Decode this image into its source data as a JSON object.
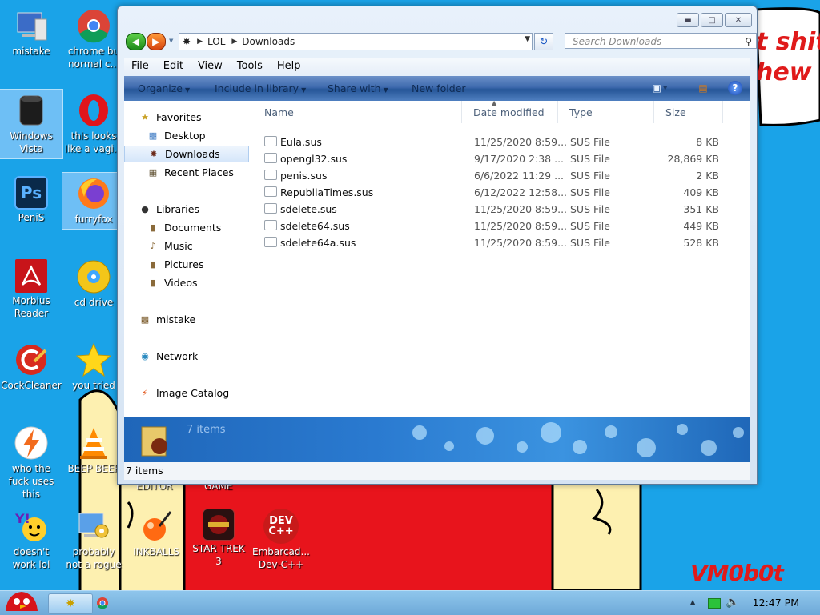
{
  "desktop": {
    "icons": [
      {
        "label": "mistake"
      },
      {
        "label": "chrome bu normal c..."
      },
      {
        "label": "Windows Vista"
      },
      {
        "label": "this looks like a vagi..."
      },
      {
        "label": "PeniS"
      },
      {
        "label": "furryfox"
      },
      {
        "label": "Morbius Reader"
      },
      {
        "label": "cd drive"
      },
      {
        "label": "CockCleaner"
      },
      {
        "label": "you tried"
      },
      {
        "label": "who the fuck uses this"
      },
      {
        "label": "BEEP BEEP"
      },
      {
        "label": "EDITOR"
      },
      {
        "label": "GAME"
      },
      {
        "label": "doesn't work lol"
      },
      {
        "label": "probably not a rogue"
      },
      {
        "label": "INKBALLS"
      },
      {
        "label": "STAR TREK 3"
      },
      {
        "label": "Embarcad... Dev-C++"
      }
    ],
    "wallpaper_text": [
      "t shit",
      "hew"
    ],
    "watermark": "VM0b0t"
  },
  "window": {
    "address": {
      "segments": [
        "LOL",
        "Downloads"
      ]
    },
    "search_placeholder": "Search Downloads",
    "menu": [
      "File",
      "Edit",
      "View",
      "Tools",
      "Help"
    ],
    "commands": [
      "Organize",
      "Include in library",
      "Share with",
      "New folder"
    ],
    "nav": {
      "favorites": "Favorites",
      "desktop": "Desktop",
      "downloads": "Downloads",
      "recent": "Recent Places",
      "libraries": "Libraries",
      "documents": "Documents",
      "music": "Music",
      "pictures": "Pictures",
      "videos": "Videos",
      "homegroup": "mistake",
      "network": "Network",
      "imagecatalog": "Image Catalog"
    },
    "columns": [
      "Name",
      "Date modified",
      "Type",
      "Size"
    ],
    "files": [
      {
        "name": "Eula.sus",
        "date": "11/25/2020 8:59...",
        "type": "SUS File",
        "size": "8 KB"
      },
      {
        "name": "opengl32.sus",
        "date": "9/17/2020 2:38 ...",
        "type": "SUS File",
        "size": "28,869 KB"
      },
      {
        "name": "penis.sus",
        "date": "6/6/2022 11:29 ...",
        "type": "SUS File",
        "size": "2 KB"
      },
      {
        "name": "RepubliaTimes.sus",
        "date": "6/12/2022 12:58...",
        "type": "SUS File",
        "size": "409 KB"
      },
      {
        "name": "sdelete.sus",
        "date": "11/25/2020 8:59...",
        "type": "SUS File",
        "size": "351 KB"
      },
      {
        "name": "sdelete64.sus",
        "date": "11/25/2020 8:59...",
        "type": "SUS File",
        "size": "449 KB"
      },
      {
        "name": "sdelete64a.sus",
        "date": "11/25/2020 8:59...",
        "type": "SUS File",
        "size": "528 KB"
      }
    ],
    "details_text": "7 items",
    "status_text": "7 items"
  },
  "taskbar": {
    "clock": "12:47 PM"
  }
}
